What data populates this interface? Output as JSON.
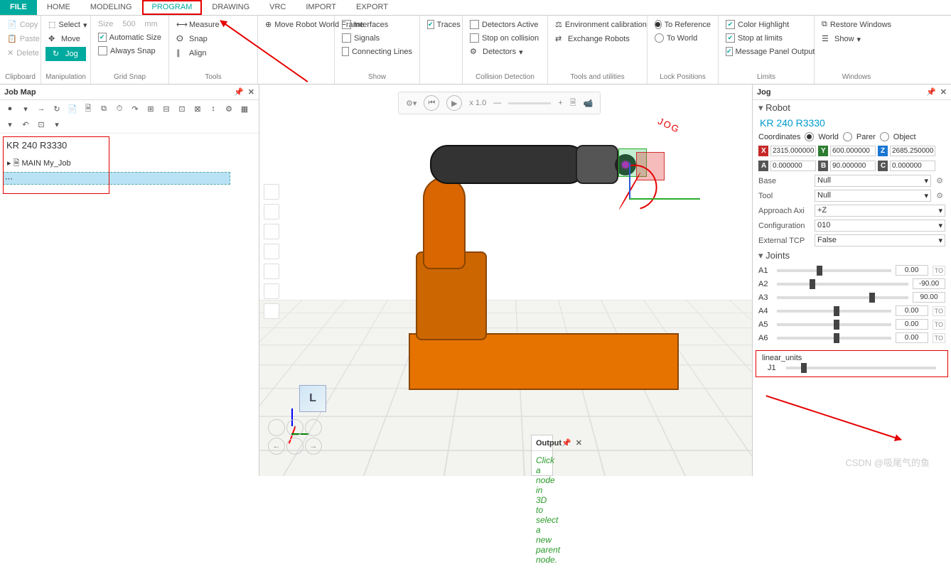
{
  "tabs": {
    "file": "FILE",
    "home": "HOME",
    "modeling": "MODELING",
    "program": "PROGRAM",
    "drawing": "DRAWING",
    "vrc": "VRC",
    "import": "IMPORT",
    "export": "EXPORT"
  },
  "ribbon": {
    "clipboard": {
      "copy": "Copy",
      "paste": "Paste",
      "delete": "Delete",
      "label": "Clipboard"
    },
    "manip": {
      "select": "Select",
      "move": "Move",
      "jog": "Jog",
      "label": "Manipulation"
    },
    "gridsnap": {
      "size": "Size",
      "sizeval": "500",
      "sizeunit": "mm",
      "auto": "Automatic Size",
      "always": "Always Snap",
      "label": "Grid Snap"
    },
    "tools": {
      "measure": "Measure",
      "snap": "Snap",
      "align": "Align",
      "label": "Tools"
    },
    "mrwf": "Move Robot World Frame",
    "show": {
      "interfaces": "Interfaces",
      "signals": "Signals",
      "connecting": "Connecting Lines",
      "label": "Show"
    },
    "traces": "Traces",
    "collision": {
      "detectors": "Detectors Active",
      "stop": "Stop on collision",
      "det": "Detectors",
      "label": "Collision Detection"
    },
    "toolsutil": {
      "env": "Environment calibration",
      "ex": "Exchange Robots",
      "label": "Tools and utilities"
    },
    "lock": {
      "toref": "To Reference",
      "toworld": "To World",
      "label": "Lock Positions"
    },
    "limits": {
      "color": "Color Highlight",
      "stop": "Stop at limits",
      "msg": "Message Panel Output",
      "label": "Limits"
    },
    "windows": {
      "restore": "Restore Windows",
      "show": "Show",
      "label": "Windows"
    }
  },
  "jobmap": {
    "title": "Job Map",
    "root": "KR 240 R3330",
    "sub": "MAIN My_Job"
  },
  "playbar": {
    "speed": "x 1.0"
  },
  "joglabel": "JOG",
  "navcube": "L",
  "output": {
    "title": "Output",
    "msg": "Click a node in 3D to select a new parent node."
  },
  "jog": {
    "title": "Jog",
    "robot_section": "Robot",
    "robotname": "KR 240 R3330",
    "coords_label": "Coordinates",
    "coord_opts": {
      "world": "World",
      "parer": "Parer",
      "object": "Object"
    },
    "x": "2315.000000",
    "y": "600.000000",
    "z": "2685.250000",
    "a": "0.000000",
    "b": "90.000000",
    "c": "0.000000",
    "base_l": "Base",
    "base_v": "Null",
    "tool_l": "Tool",
    "tool_v": "Null",
    "app_l": "Approach Axi",
    "app_v": "+Z",
    "conf_l": "Configuration",
    "conf_v": "010",
    "ext_l": "External TCP",
    "ext_v": "False",
    "joints_section": "Joints",
    "joints": [
      {
        "n": "A1",
        "v": "0.00",
        "p": 35,
        "to": "TO"
      },
      {
        "n": "A2",
        "v": "-90.00",
        "p": 25
      },
      {
        "n": "A3",
        "v": "90.00",
        "p": 70
      },
      {
        "n": "A4",
        "v": "0.00",
        "p": 50,
        "to": "TO"
      },
      {
        "n": "A5",
        "v": "0.00",
        "p": 50,
        "to": "TO"
      },
      {
        "n": "A6",
        "v": "0.00",
        "p": 50,
        "to": "TO"
      }
    ],
    "linunits": "linear_units",
    "j1": "J1"
  },
  "watermark": "CSDN @吸尾气的鱼"
}
